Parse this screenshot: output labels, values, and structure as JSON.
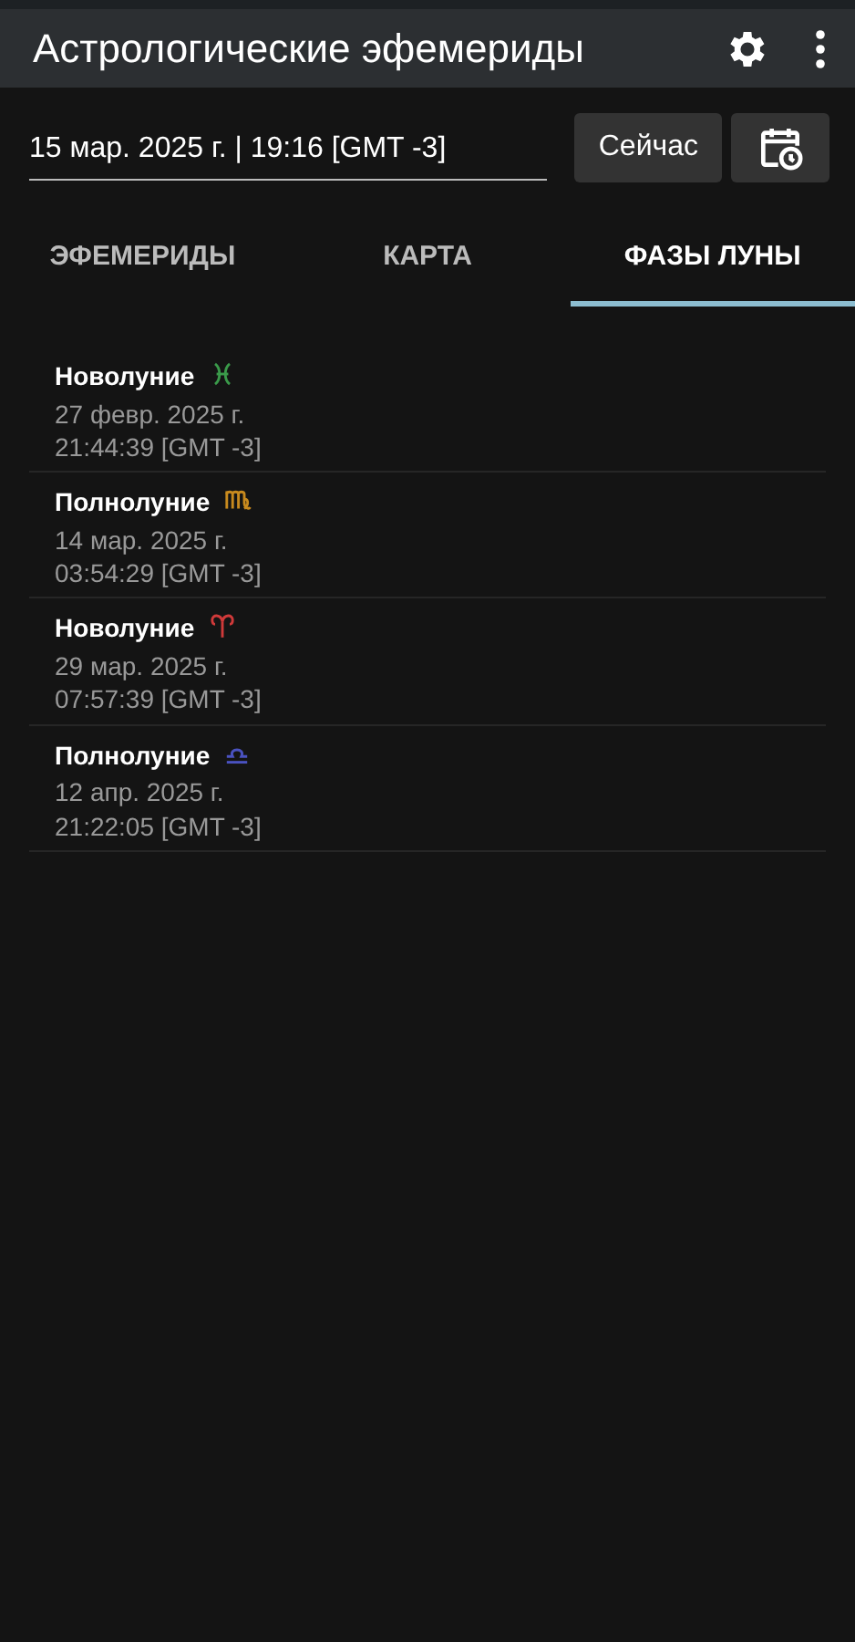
{
  "app_bar": {
    "title": "Астрологические эфемериды"
  },
  "date_field": {
    "value": "15 мар. 2025 г. | 19:16 [GMT -3]"
  },
  "now_button": "Сейчас",
  "tabs": [
    {
      "label": "ЭФЕМЕРИДЫ",
      "selected": false
    },
    {
      "label": "КАРТА",
      "selected": false
    },
    {
      "label": "ФАЗЫ ЛУНЫ",
      "selected": true
    }
  ],
  "phases": [
    {
      "title": "Новолуние",
      "kind": "pisces",
      "color": "#3a9a4a",
      "date": "27 февр. 2025 г.",
      "time": "21:44:39 [GMT -3]"
    },
    {
      "title": "Полнолуние",
      "kind": "virgo",
      "color": "#c88a1e",
      "date": "14 мар. 2025 г.",
      "time": "03:54:29 [GMT -3]"
    },
    {
      "title": "Новолуние",
      "kind": "aries",
      "color": "#d03a3a",
      "date": "29 мар. 2025 г.",
      "time": "07:57:39 [GMT -3]"
    },
    {
      "title": "Полнолуние",
      "kind": "libra",
      "color": "#4a52c0",
      "date": "12 апр. 2025 г.",
      "time": "21:22:05 [GMT -3]"
    }
  ]
}
